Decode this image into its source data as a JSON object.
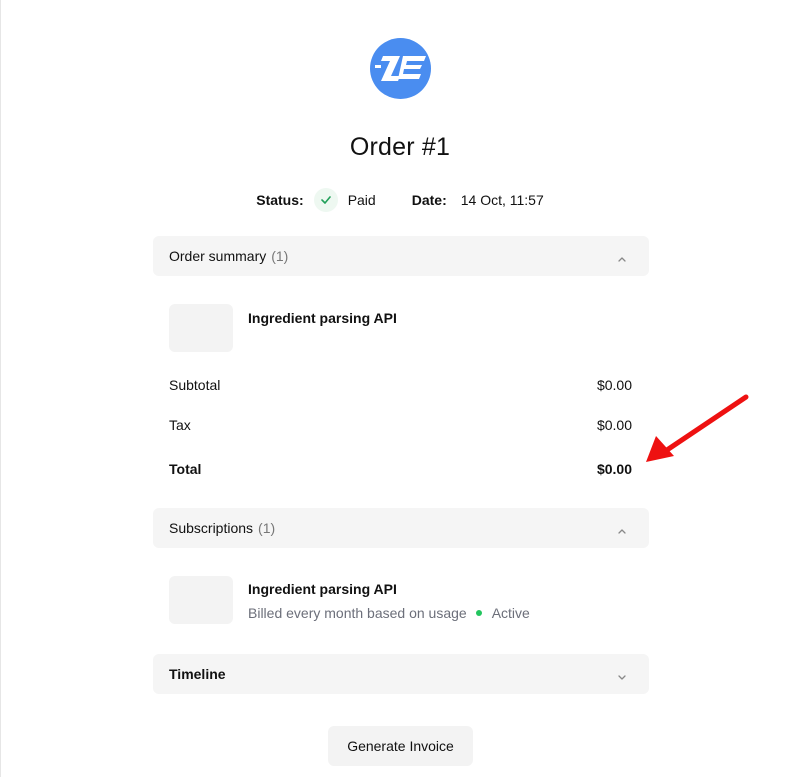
{
  "order": {
    "title": "Order #1",
    "status_label": "Status:",
    "status_value": "Paid",
    "date_label": "Date:",
    "date_value": "14 Oct, 11:57"
  },
  "order_summary": {
    "title": "Order summary",
    "count": "(1)",
    "items": [
      {
        "name": "Ingredient parsing API"
      }
    ],
    "subtotal_label": "Subtotal",
    "subtotal_value": "$0.00",
    "tax_label": "Tax",
    "tax_value": "$0.00",
    "total_label": "Total",
    "total_value": "$0.00"
  },
  "subscriptions": {
    "title": "Subscriptions",
    "count": "(1)",
    "items": [
      {
        "name": "Ingredient parsing API",
        "billing": "Billed every month based on usage",
        "state": "Active"
      }
    ]
  },
  "timeline": {
    "title": "Timeline"
  },
  "actions": {
    "generate_invoice": "Generate Invoice"
  },
  "colors": {
    "logo": "#4a8df0",
    "active_dot": "#22c55e",
    "check": "#22a05a",
    "annotation_arrow": "#ee1111"
  },
  "icons": {
    "logo": "brand-logo",
    "status": "check-icon",
    "collapse": "chevron-up-icon",
    "expand": "chevron-down-icon",
    "annotation": "arrow-annotation"
  }
}
